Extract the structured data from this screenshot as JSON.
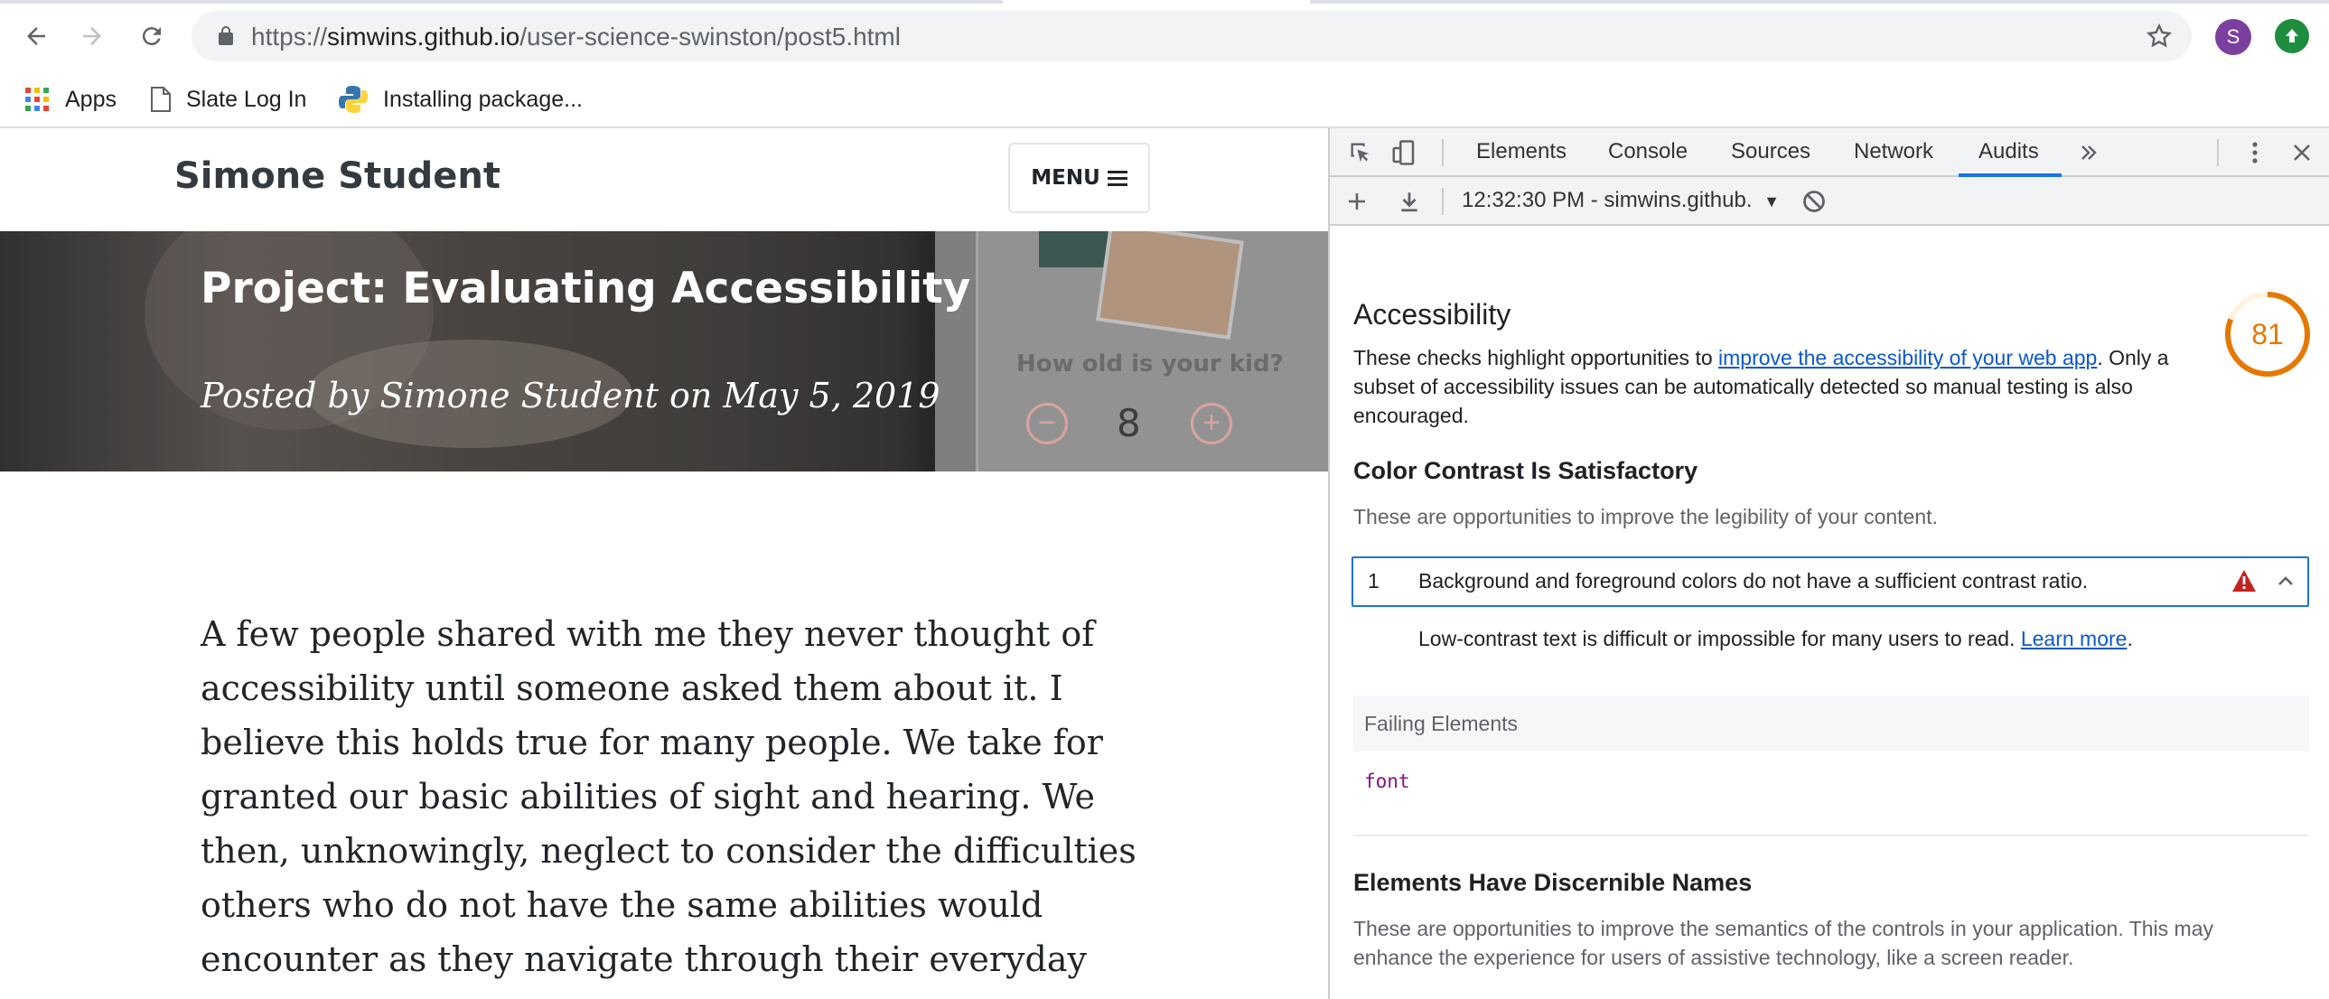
{
  "browser": {
    "url_scheme": "https://",
    "url_host": "simwins.github.io",
    "url_path": "/user-science-swinston/post5.html",
    "avatar_letter": "S",
    "bookmarks": [
      {
        "label": "Apps",
        "icon": "apps-grid-icon"
      },
      {
        "label": "Slate Log In",
        "icon": "page-icon"
      },
      {
        "label": "Installing package...",
        "icon": "python-icon"
      }
    ]
  },
  "site": {
    "brand": "Simone Student",
    "menu_label": "MENU",
    "hero_title": "Project: Evaluating Accessibility",
    "hero_subtitle": "Posted by Simone Student on May 5, 2019",
    "hero_image": {
      "question": "How old is your kid?",
      "minus": "−",
      "value": "8",
      "plus": "+"
    },
    "article_lines": [
      "A few people shared with me they never thought of",
      "accessibility until someone asked them about it. I",
      "believe this holds true for many people. We take for",
      "granted our basic abilities of sight and hearing. We",
      "then, unknowingly, neglect to consider the difficulties",
      "others who do not have the same abilities would",
      "encounter as they navigate through their everyday"
    ]
  },
  "devtools": {
    "tabs": [
      "Elements",
      "Console",
      "Sources",
      "Network",
      "Audits"
    ],
    "active_tab": "Audits",
    "report_selector": "12:32:30 PM - simwins.github.",
    "category": {
      "title": "Accessibility",
      "score": "81",
      "score_fraction": 0.81,
      "score_color": "#e67700",
      "desc_before": "These checks highlight opportunities to ",
      "desc_link": "improve the accessibility of your web app",
      "desc_after": ". Only a subset of accessibility issues can be automatically detected so manual testing is also encouraged."
    },
    "groups": [
      {
        "title": "Color Contrast Is Satisfactory",
        "description": "These are opportunities to improve the legibility of your content.",
        "audit": {
          "index": "1",
          "title": "Background and foreground colors do not have a sufficient contrast ratio.",
          "help_text": "Low-contrast text is difficult or impossible for many users to read. ",
          "help_link": "Learn more",
          "help_end": ".",
          "table_header": "Failing Elements",
          "failing_node": "font"
        }
      },
      {
        "title": "Elements Have Discernible Names",
        "description": "These are opportunities to improve the semantics of the controls in your application. This may enhance the experience for users of assistive technology, like a screen reader."
      }
    ]
  }
}
